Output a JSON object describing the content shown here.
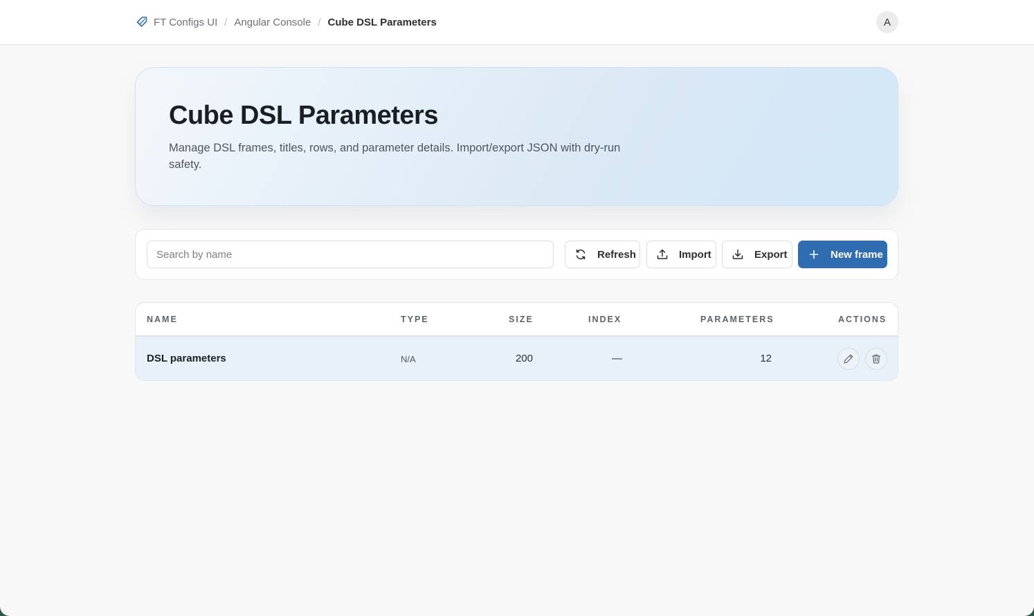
{
  "breadcrumb": {
    "items": [
      "FT Configs UI",
      "Angular Console"
    ],
    "current": "Cube DSL Parameters",
    "separator": "/"
  },
  "user": {
    "avatar_initial": "A"
  },
  "hero": {
    "title": "Cube DSL Parameters",
    "description": "Manage DSL frames, titles, rows, and parameter details. Import/export JSON with dry-run safety."
  },
  "toolbar": {
    "search_placeholder": "Search by name",
    "refresh_label": "Refresh",
    "import_label": "Import",
    "export_label": "Export",
    "new_label": "New frame"
  },
  "table": {
    "headers": {
      "name": "NAME",
      "type": "TYPE",
      "size": "SIZE",
      "index": "INDEX",
      "parameters": "PARAMETERS",
      "actions": "ACTIONS"
    },
    "rows": [
      {
        "name": "DSL parameters",
        "type": "N/A",
        "size": "200",
        "index": "—",
        "parameters": "12"
      }
    ]
  },
  "colors": {
    "accent": "#2f6db0",
    "row_highlight": "#e8f1fa",
    "background": "#f8f8f8"
  },
  "icons": [
    "tag-icon",
    "refresh-icon",
    "upload-icon",
    "download-icon",
    "plus-icon",
    "pencil-icon",
    "trash-icon"
  ]
}
